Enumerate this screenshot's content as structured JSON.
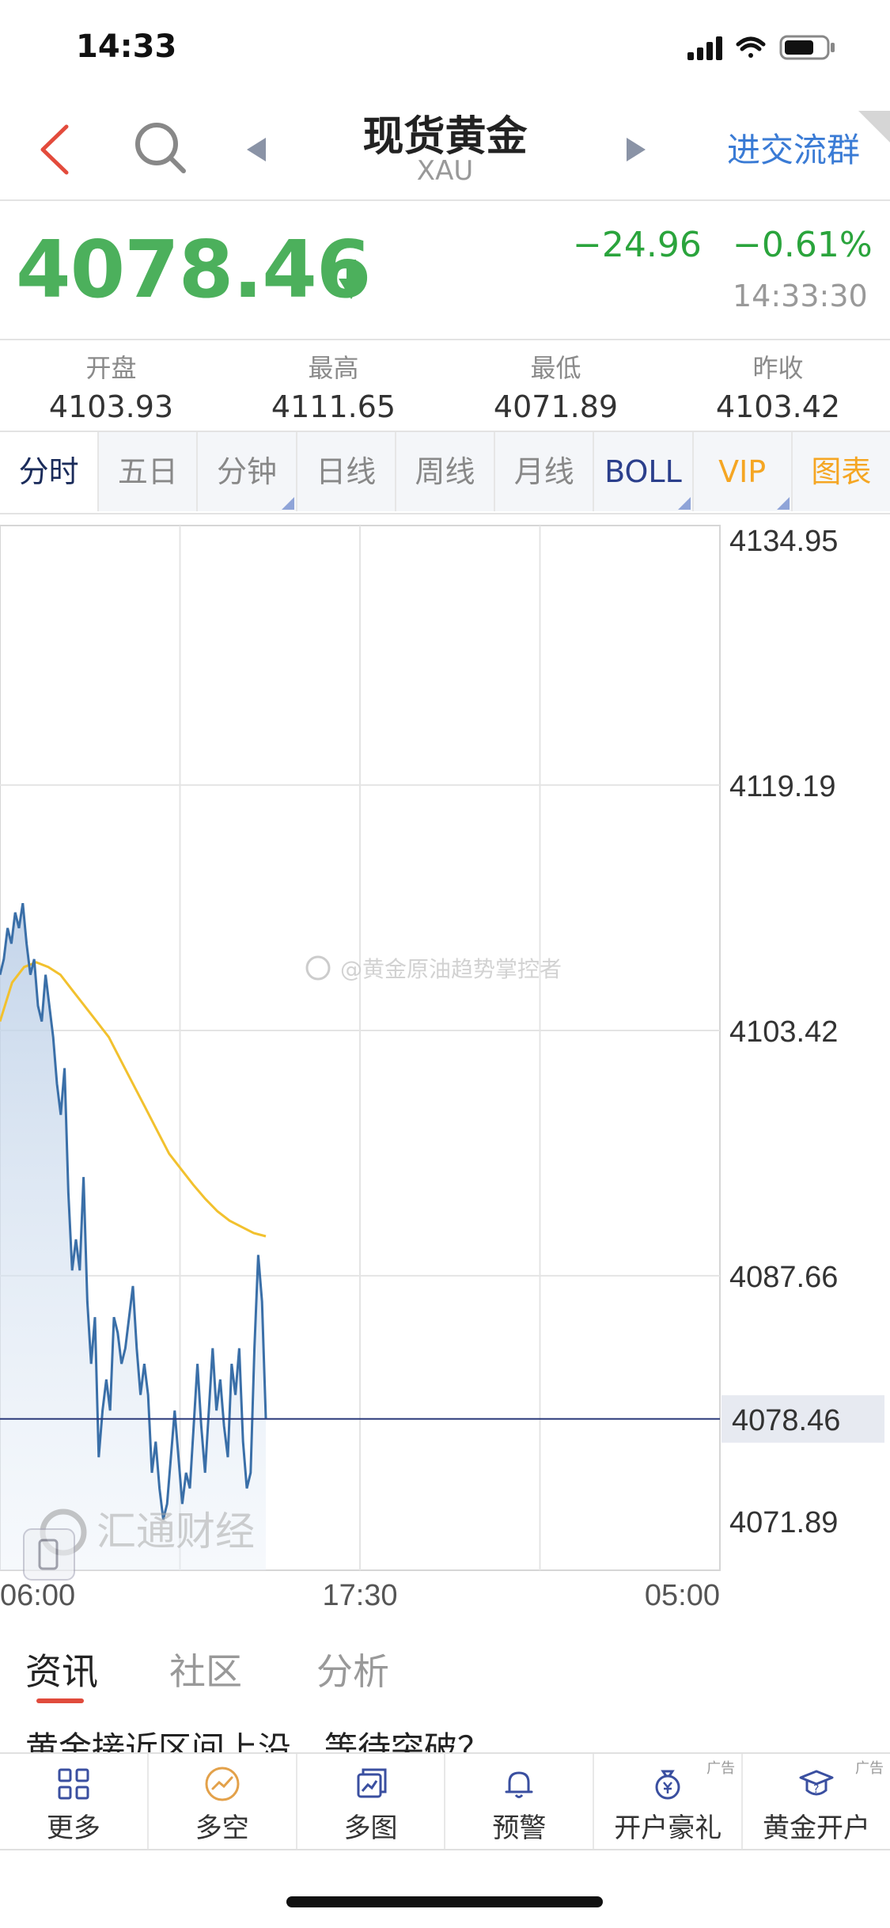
{
  "status_bar": {
    "time": "14:33"
  },
  "nav": {
    "title": "现货黄金",
    "subtitle": "XAU",
    "group_link": "进交流群"
  },
  "quote": {
    "price": "4078.46",
    "change": "−24.96",
    "change_pct": "−0.61%",
    "time": "14:33:30",
    "stats": [
      {
        "label": "开盘",
        "value": "4103.93"
      },
      {
        "label": "最高",
        "value": "4111.65"
      },
      {
        "label": "最低",
        "value": "4071.89"
      },
      {
        "label": "昨收",
        "value": "4103.42"
      }
    ]
  },
  "tabs": [
    "分时",
    "五日",
    "分钟",
    "日线",
    "周线",
    "月线",
    "BOLL",
    "VIP",
    "图表"
  ],
  "chart_data": {
    "type": "line",
    "y_ticks": [
      "4134.95",
      "4119.19",
      "4103.42",
      "4087.66",
      "4071.89"
    ],
    "current_price_label": "4078.46",
    "x_ticks": [
      "06:00",
      "17:30",
      "05:00"
    ],
    "ylim": [
      4071.89,
      4134.95
    ],
    "watermark": "@黄金原油趋势掌控者",
    "logo_text": "汇通财经",
    "series": [
      {
        "values": [
          4107,
          4108,
          4110,
          4109,
          4111,
          4110,
          4111.6,
          4109,
          4107,
          4108,
          4105,
          4104,
          4107,
          4105,
          4103,
          4100,
          4098,
          4101,
          4093,
          4088,
          4090,
          4088,
          4094,
          4086,
          4082,
          4085,
          4076,
          4079,
          4081,
          4079,
          4085,
          4084,
          4082,
          4083,
          4085,
          4087,
          4083,
          4080,
          4082,
          4080,
          4075,
          4077,
          4074,
          4072,
          4073,
          4076,
          4079,
          4076,
          4073,
          4075,
          4074,
          4078,
          4082,
          4078,
          4075,
          4079,
          4083,
          4079,
          4081,
          4078,
          4076,
          4082,
          4080,
          4083,
          4077,
          4074,
          4075,
          4083,
          4089,
          4086,
          4078.5
        ],
        "color": "#3a6fa8"
      },
      {
        "values": [
          4104,
          4106.5,
          4107.5,
          4107.8,
          4107.5,
          4107,
          4106,
          4105,
          4104,
          4103,
          4101.5,
          4100,
          4098.5,
          4097,
          4095.5,
          4094.5,
          4093.5,
          4092.6,
          4091.8,
          4091.2,
          4090.8,
          4090.4,
          4090.2
        ],
        "color": "#f2c12e"
      }
    ]
  },
  "news_tabs": [
    "资讯",
    "社区",
    "分析"
  ],
  "headline": "黄金接近区间上沿，等待突破？",
  "toolbar": [
    {
      "label": "更多",
      "icon": "grid-icon"
    },
    {
      "label": "多空",
      "icon": "trend-circle-icon"
    },
    {
      "label": "多图",
      "icon": "multi-chart-icon"
    },
    {
      "label": "预警",
      "icon": "bell-icon"
    },
    {
      "label": "开户豪礼",
      "icon": "money-bag-icon",
      "ad": "广告"
    },
    {
      "label": "黄金开户",
      "icon": "graduation-icon",
      "ad": "广告"
    }
  ]
}
